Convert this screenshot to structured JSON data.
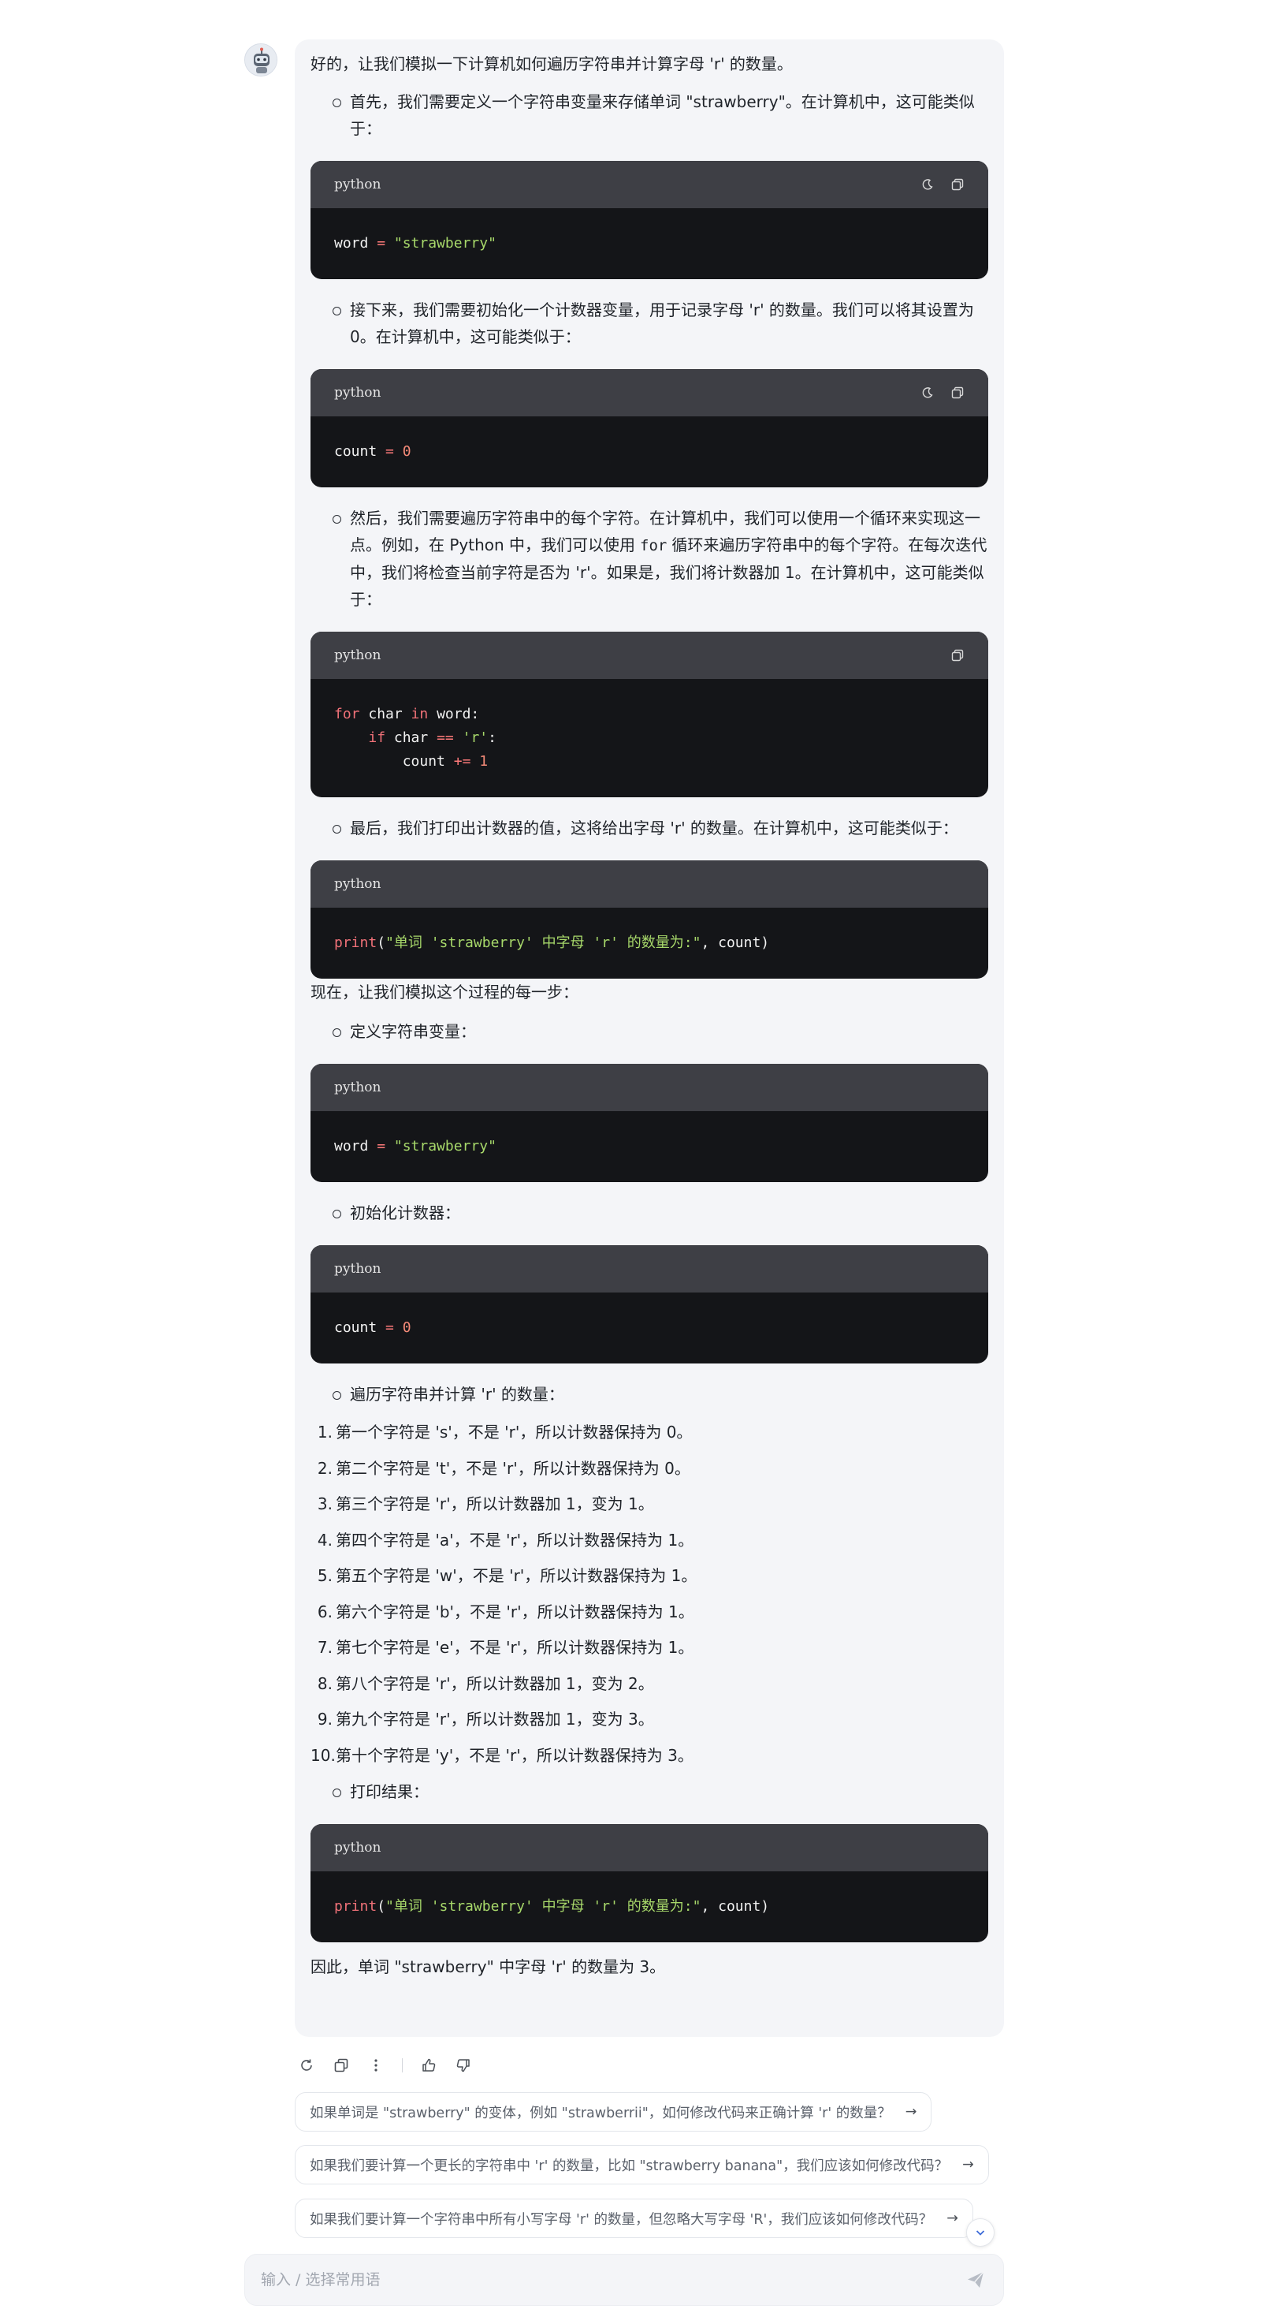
{
  "avatar": {
    "icon": "robot-avatar-icon"
  },
  "message": {
    "intro": "好的，让我们模拟一下计算机如何遍历字符串并计算字母 'r' 的数量。",
    "bullet1": "首先，我们需要定义一个字符串变量来存储单词 \"strawberry\"。在计算机中，这可能类似于：",
    "code1": {
      "lang": "python",
      "p1": "word",
      "p2": " = ",
      "p3": "\"strawberry\""
    },
    "bullet2": "接下来，我们需要初始化一个计数器变量，用于记录字母 'r' 的数量。我们可以将其设置为 0。在计算机中，这可能类似于：",
    "code2": {
      "lang": "python",
      "p1": "count",
      "p2": " = ",
      "p3": "0"
    },
    "bullet3_a": "然后，我们需要遍历字符串中的每个字符。在计算机中，我们可以使用一个循环来实现这一点。例如，在 Python 中，我们可以使用",
    "bullet3_code": "for",
    "bullet3_b": "循环来遍历字符串中的每个字符。在每次迭代中，我们将检查当前字符是否为 'r'。如果是，我们将计数器加 1。在计算机中，这可能类似于：",
    "code3": {
      "lang": "python",
      "l1_kw1": "for",
      "l1_a": " char ",
      "l1_kw2": "in",
      "l1_b": " word:",
      "l2_indent": "    ",
      "l2_kw": "if",
      "l2_a": " char ",
      "l2_op": "==",
      "l2_sp": " ",
      "l2_str": "'r'",
      "l2_b": ":",
      "l3_indent": "        ",
      "l3_a": "count ",
      "l3_op": "+=",
      "l3_sp": " ",
      "l3_num": "1"
    },
    "bullet4": "最后，我们打印出计数器的值，这将给出字母 'r' 的数量。在计算机中，这可能类似于：",
    "code4": {
      "lang": "python",
      "fn": "print",
      "open": "(",
      "str": "\"单词 'strawberry' 中字母 'r' 的数量为:\"",
      "rest": ", count)"
    },
    "simulate_intro": "现在，让我们模拟这个过程的每一步：",
    "step_define": "定义字符串变量：",
    "code5": {
      "lang": "python",
      "p1": "word",
      "p2": " = ",
      "p3": "\"strawberry\""
    },
    "step_init": "初始化计数器：",
    "code6": {
      "lang": "python",
      "p1": "count",
      "p2": " = ",
      "p3": "0"
    },
    "step_traverse": "遍历字符串并计算 'r' 的数量：",
    "steps": [
      {
        "n": "1.",
        "text": "第一个字符是 's'，不是 'r'，所以计数器保持为 0。"
      },
      {
        "n": "2.",
        "text": "第二个字符是 't'，不是 'r'，所以计数器保持为 0。"
      },
      {
        "n": "3.",
        "text": "第三个字符是 'r'，所以计数器加 1，变为 1。"
      },
      {
        "n": "4.",
        "text": "第四个字符是 'a'，不是 'r'，所以计数器保持为 1。"
      },
      {
        "n": "5.",
        "text": "第五个字符是 'w'，不是 'r'，所以计数器保持为 1。"
      },
      {
        "n": "6.",
        "text": "第六个字符是 'b'，不是 'r'，所以计数器保持为 1。"
      },
      {
        "n": "7.",
        "text": "第七个字符是 'e'，不是 'r'，所以计数器保持为 1。"
      },
      {
        "n": "8.",
        "text": "第八个字符是 'r'，所以计数器加 1，变为 2。"
      },
      {
        "n": "9.",
        "text": "第九个字符是 'r'，所以计数器加 1，变为 3。"
      },
      {
        "n": "10.",
        "text": "第十个字符是 'y'，不是 'r'，所以计数器保持为 3。"
      }
    ],
    "step_print": "打印结果：",
    "code7": {
      "lang": "python",
      "fn": "print",
      "open": "(",
      "str": "\"单词 'strawberry' 中字母 'r' 的数量为:\"",
      "rest": ", count)"
    },
    "conclusion": "因此，单词 \"strawberry\" 中字母 'r' 的数量为 3。"
  },
  "actions": [
    "refresh-icon",
    "copy-icon",
    "more-icon",
    "thumbs-up-icon",
    "thumbs-down-icon"
  ],
  "suggestions": [
    "如果单词是 \"strawberry\" 的变体，例如 \"strawberrii\"，如何修改代码来正确计算 'r' 的数量？",
    "如果我们要计算一个更长的字符串中 'r' 的数量，比如 \"strawberry banana\"，我们应该如何修改代码？",
    "如果我们要计算一个字符串中所有小写字母 'r' 的数量，但忽略大写字母 'R'，我们应该如何修改代码？"
  ],
  "suggestion_arrow": "→",
  "input": {
    "placeholder": "输入 / 选择常用语"
  },
  "colors": {
    "code_bg": "#141518",
    "code_header": "#3e3f45",
    "keyword": "#f07178",
    "string": "#a7d86a",
    "number": "#f48a78",
    "bubble_bg": "#f4f5f8"
  }
}
